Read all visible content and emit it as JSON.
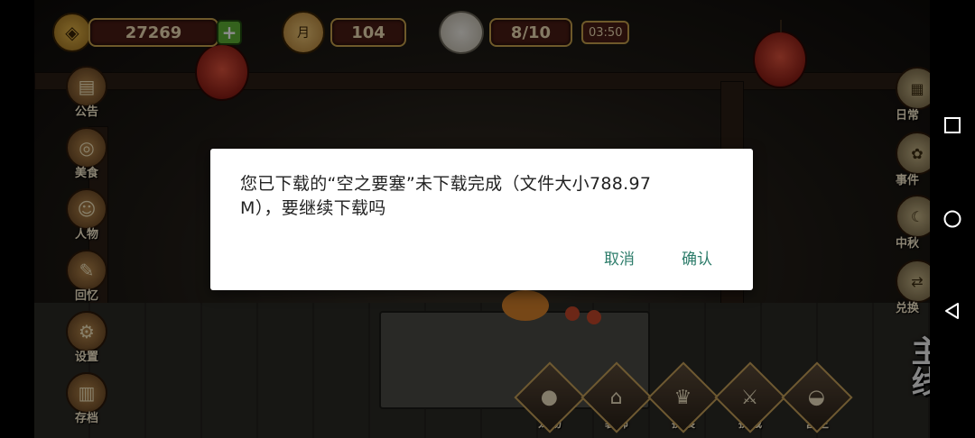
{
  "hud": {
    "copper_coins": "27269",
    "mooncake_count": "104",
    "mooncake_label": "月",
    "stamina": "8/10",
    "stamina_timer": "03:50"
  },
  "left_menu": [
    {
      "label": "公告",
      "icon": "notice-board-icon"
    },
    {
      "label": "美食",
      "icon": "food-basket-icon"
    },
    {
      "label": "人物",
      "icon": "character-icon"
    },
    {
      "label": "回忆",
      "icon": "scroll-memory-icon"
    },
    {
      "label": "设置",
      "icon": "settings-coin-icon"
    },
    {
      "label": "存档",
      "icon": "save-book-icon"
    }
  ],
  "right_menu": [
    {
      "label": "日常",
      "icon": "daily-scroll-icon"
    },
    {
      "label": "事件",
      "icon": "event-icon"
    },
    {
      "label": "中秋",
      "icon": "mid-autumn-icon"
    },
    {
      "label": "兑换",
      "icon": "exchange-icon"
    }
  ],
  "bottom_menu": [
    {
      "label": "宠物",
      "icon": "panda-pet-icon"
    },
    {
      "label": "装饰",
      "icon": "decoration-house-icon"
    },
    {
      "label": "换装",
      "icon": "outfit-icon"
    },
    {
      "label": "挑战",
      "icon": "challenge-icon"
    },
    {
      "label": "营生",
      "icon": "gold-ingot-icon"
    }
  ],
  "main_quest": {
    "label": "主线"
  },
  "dialog": {
    "message": "您已下载的“空之要塞”未下载完成（文件大小788.97 M），要继续下载吗",
    "cancel_label": "取消",
    "confirm_label": "确认",
    "accent_color": "#2e7d6b"
  },
  "system_nav": {
    "square": "recent-apps-icon",
    "circle": "home-icon",
    "triangle": "back-icon"
  }
}
